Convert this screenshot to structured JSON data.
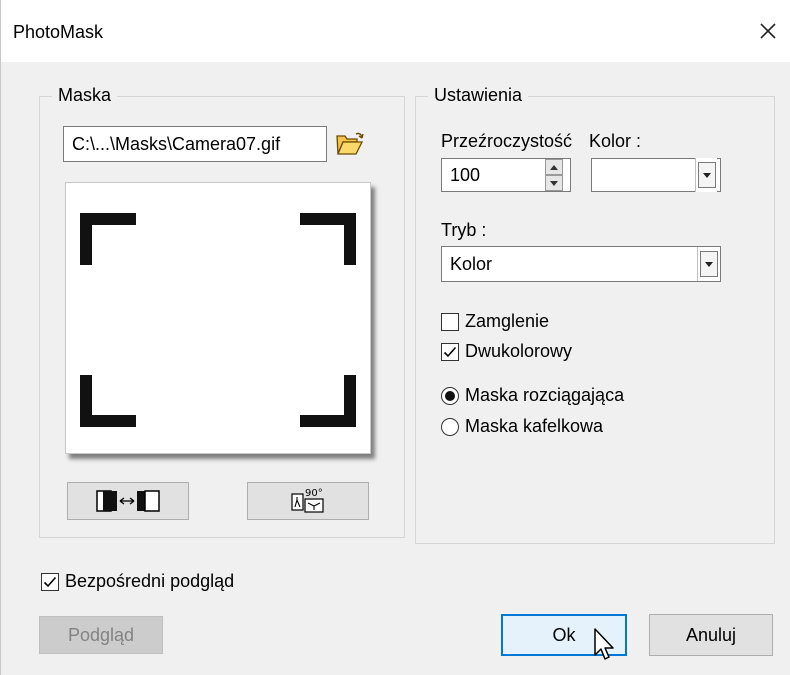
{
  "window": {
    "title": "PhotoMask"
  },
  "mask_group": {
    "label": "Maska",
    "file_path": "C:\\...\\Masks\\Camera07.gif"
  },
  "settings_group": {
    "label": "Ustawienia",
    "transparency_label": "Przeźroczystość",
    "transparency_value": "100",
    "color_label": "Kolor :",
    "mode_label": "Tryb :",
    "mode_value": "Kolor",
    "checkboxes": [
      {
        "label": "Zamglenie",
        "checked": false
      },
      {
        "label": "Dwukolorowy",
        "checked": true
      }
    ],
    "radios": [
      {
        "label": "Maska rozciągająca",
        "selected": true
      },
      {
        "label": "Maska kafelkowa",
        "selected": false
      }
    ]
  },
  "direct_preview": {
    "label": "Bezpośredni podgląd",
    "checked": true
  },
  "buttons": {
    "preview": "Podgląd",
    "ok": "Ok",
    "cancel": "Anuluj"
  },
  "colors": {
    "accent": "#0078d7",
    "dialog_bg": "#f0f0f0"
  },
  "icons": {
    "close": "close-icon",
    "folder": "folder-open-icon",
    "flip": "flip-horizontal-icon",
    "rotate": "rotate-90-icon"
  }
}
